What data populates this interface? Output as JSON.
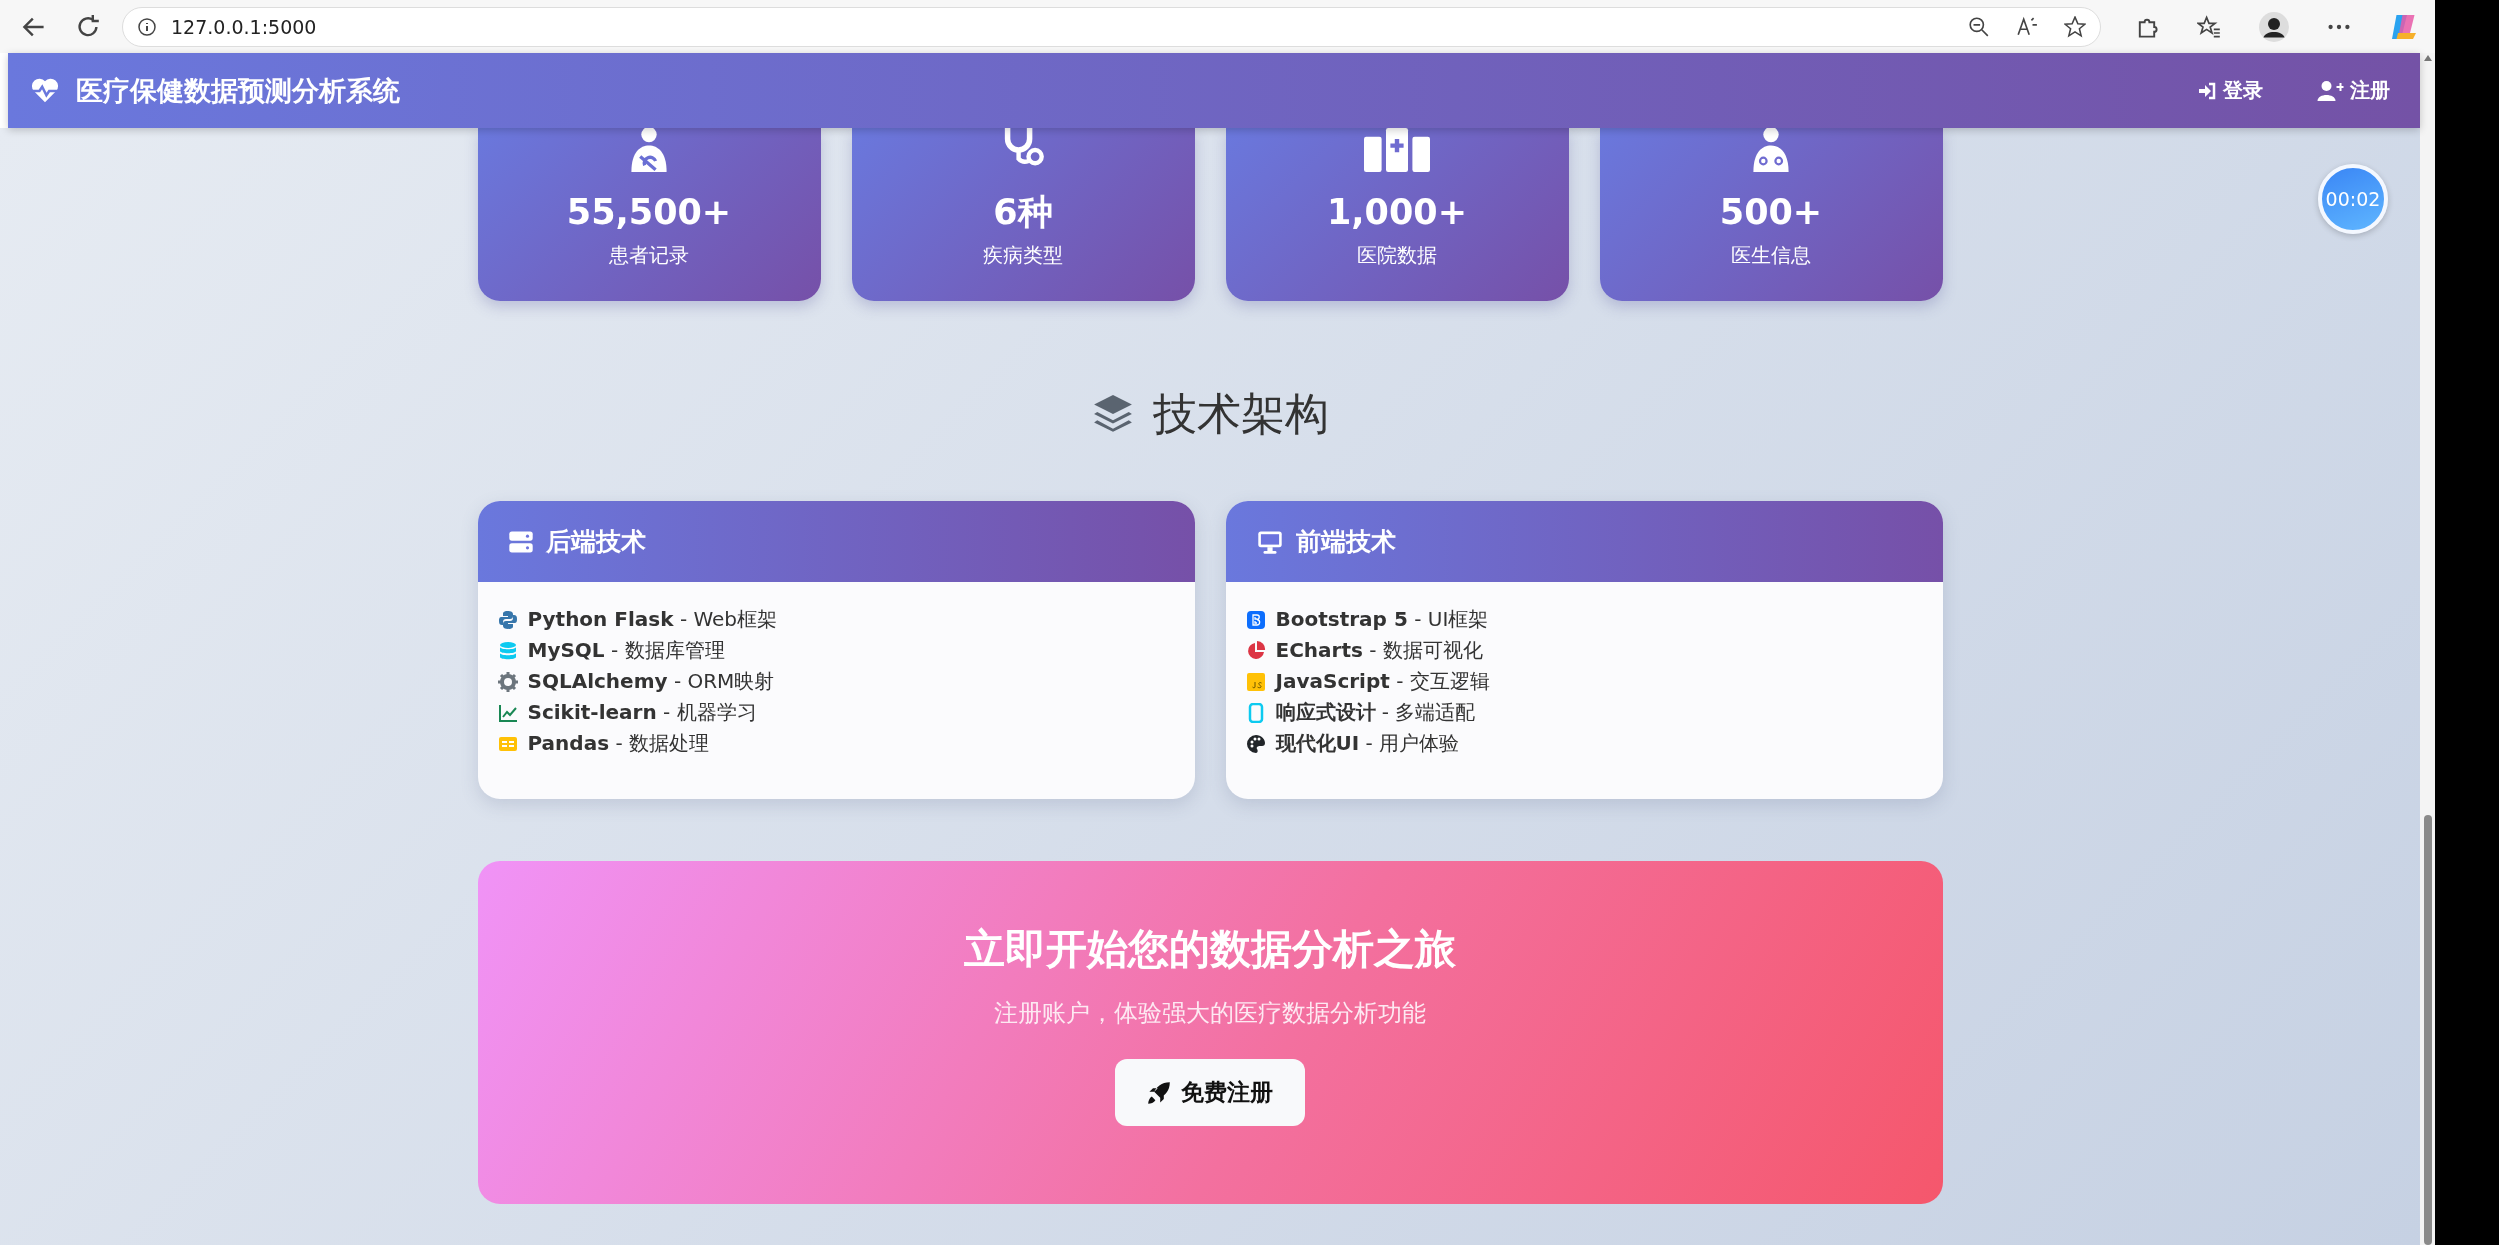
{
  "browser": {
    "url": "127.0.0.1:5000"
  },
  "navbar": {
    "brand": "医疗保健数据预测分析系统",
    "links": [
      {
        "kind": "login",
        "label": "登录"
      },
      {
        "kind": "register",
        "label": "注册"
      }
    ]
  },
  "timer": "00:02",
  "stats": [
    {
      "kind": "patient",
      "value": "55,500+",
      "label": "患者记录"
    },
    {
      "kind": "stethoscope",
      "value": "6种",
      "label": "疾病类型"
    },
    {
      "kind": "hospital",
      "value": "1,000+",
      "label": "医院数据"
    },
    {
      "kind": "doctor",
      "value": "500+",
      "label": "医生信息"
    }
  ],
  "tech_section": {
    "title": "技术架构",
    "cards": [
      {
        "kind": "server",
        "title": "后端技术",
        "items": [
          {
            "kind": "python",
            "text": "**Python Flask** - Web框架"
          },
          {
            "kind": "database",
            "text": "**MySQL** - 数据库管理"
          },
          {
            "kind": "gear",
            "text": "**SQLAlchemy** - ORM映射"
          },
          {
            "kind": "chart",
            "text": "**Scikit-learn** - 机器学习"
          },
          {
            "kind": "table",
            "text": "**Pandas** - 数据处理"
          }
        ]
      },
      {
        "kind": "monitor",
        "title": "前端技术",
        "items": [
          {
            "kind": "bootstrap",
            "text": "**Bootstrap 5** - UI框架"
          },
          {
            "kind": "pie",
            "text": "**ECharts** - 数据可视化"
          },
          {
            "kind": "js",
            "text": "**JavaScript** - 交互逻辑"
          },
          {
            "kind": "mobile",
            "text": "**响应式设计** - 多端适配"
          },
          {
            "kind": "palette",
            "text": "**现代化UI** - 用户体验"
          }
        ]
      }
    ]
  },
  "cta": {
    "title": "立即开始您的数据分析之旅",
    "subtitle": "注册账户，体验强大的医疗数据分析功能",
    "button": "免费注册"
  }
}
